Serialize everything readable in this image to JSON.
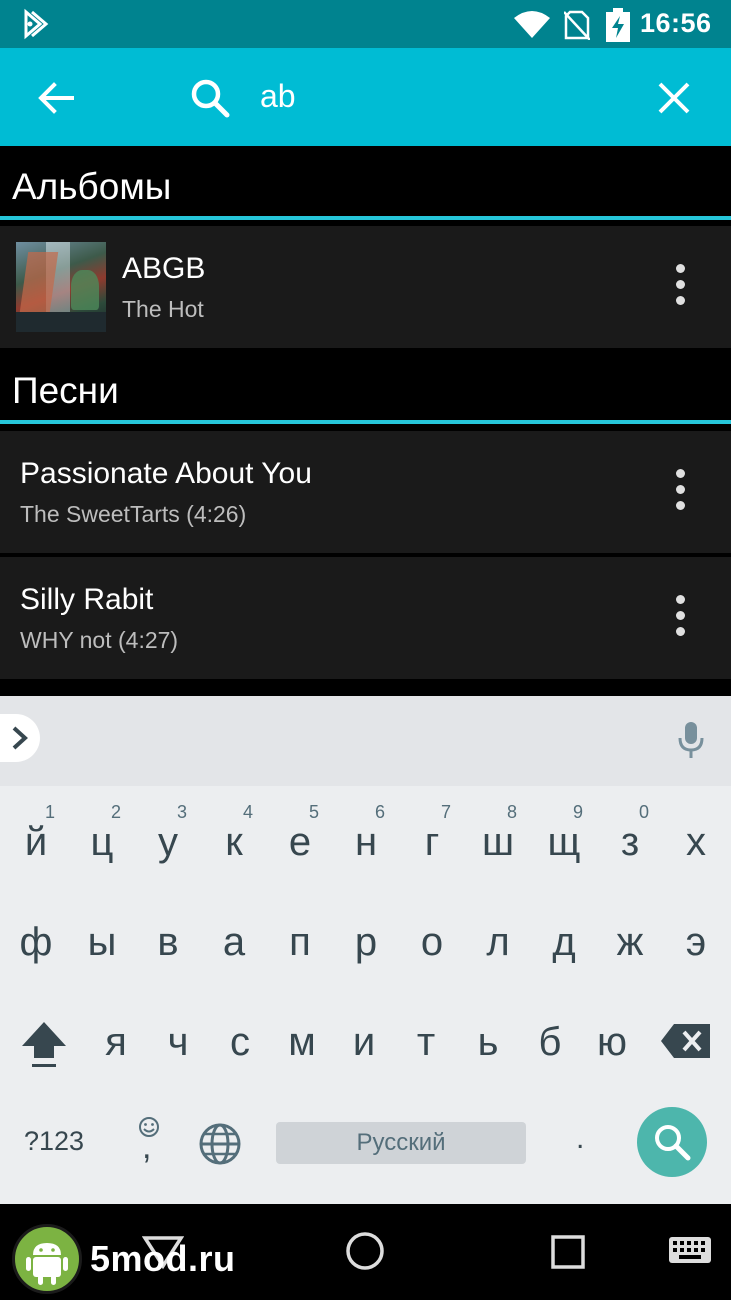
{
  "status_bar": {
    "time": "16:56",
    "icons": [
      "app-notification-icon",
      "wifi-icon",
      "no-sim-icon",
      "battery-charging-icon"
    ]
  },
  "search": {
    "query": "ab",
    "icons": [
      "back-arrow-icon",
      "search-icon",
      "close-icon"
    ]
  },
  "albums": {
    "header": "Альбомы",
    "items": [
      {
        "title": "ABGB",
        "subtitle": "The Hot"
      }
    ]
  },
  "songs": {
    "header": "Песни",
    "items": [
      {
        "title": "Passionate About You",
        "subtitle": "The SweetTarts (4:26)"
      },
      {
        "title": "Silly Rabit",
        "subtitle": "WHY not (4:27)"
      }
    ]
  },
  "keyboard": {
    "row1": [
      "й",
      "ц",
      "у",
      "к",
      "е",
      "н",
      "г",
      "ш",
      "щ",
      "з",
      "х"
    ],
    "row1_hints": [
      "1",
      "2",
      "3",
      "4",
      "5",
      "6",
      "7",
      "8",
      "9",
      "0",
      ""
    ],
    "row2": [
      "ф",
      "ы",
      "в",
      "а",
      "п",
      "р",
      "о",
      "л",
      "д",
      "ж",
      "э"
    ],
    "row3": [
      "я",
      "ч",
      "с",
      "м",
      "и",
      "т",
      "ь",
      "б",
      "ю"
    ],
    "symbols_label": "?123",
    "comma": ",",
    "space_label": "Русский",
    "period": ".",
    "icons": [
      "chevron-right-icon",
      "microphone-icon",
      "shift-icon",
      "backspace-icon",
      "emoji-icon",
      "globe-icon",
      "search-icon"
    ]
  },
  "nav_bar": {
    "icons": [
      "back-triangle-icon",
      "home-circle-icon",
      "recents-square-icon",
      "keyboard-icon"
    ]
  },
  "watermark": {
    "text": "5mod.ru"
  }
}
